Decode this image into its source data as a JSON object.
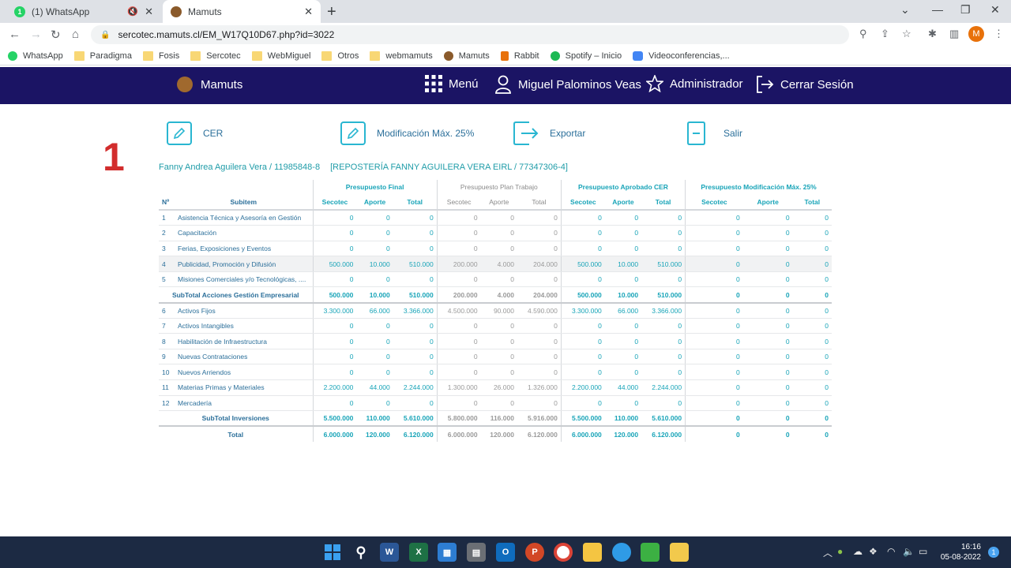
{
  "browser": {
    "tabs": [
      {
        "title": "(1) WhatsApp",
        "active": false
      },
      {
        "title": "Mamuts",
        "active": true
      }
    ],
    "url": "sercotec.mamuts.cl/EM_W17Q10D67.php?id=3022",
    "profile_initial": "M",
    "bookmarks": [
      {
        "label": "WhatsApp",
        "icon": "whatsapp-icon"
      },
      {
        "label": "Paradigma",
        "icon": "folder-icon"
      },
      {
        "label": "Fosis",
        "icon": "folder-icon"
      },
      {
        "label": "Sercotec",
        "icon": "folder-icon"
      },
      {
        "label": "WebMiguel",
        "icon": "folder-icon"
      },
      {
        "label": "Otros",
        "icon": "folder-icon"
      },
      {
        "label": "webmamuts",
        "icon": "folder-icon"
      },
      {
        "label": "Mamuts",
        "icon": "mamuts-icon"
      },
      {
        "label": "Rabbit",
        "icon": "rabbit-icon"
      },
      {
        "label": "Spotify – Inicio",
        "icon": "spotify-icon"
      },
      {
        "label": "Videoconferencias,...",
        "icon": "video-icon"
      }
    ]
  },
  "header": {
    "brand": "Mamuts",
    "menu": "Menú",
    "user": "Miguel Palominos Veas",
    "role": "Administrador",
    "logout": "Cerrar Sesión",
    "bg_color": "#1b1464"
  },
  "page": {
    "number": "1",
    "actions": {
      "cer": "CER",
      "modificacion": "Modificación Máx. 25%",
      "exportar": "Exportar",
      "salir": "Salir"
    },
    "owner": "Fanny Andrea Aguilera Vera / 11985848-8",
    "company": "[REPOSTERÍA FANNY AGUILERA VERA EIRL / 77347306-4]"
  },
  "table": {
    "groups": {
      "final": "Presupuesto Final",
      "plan": "Presupuesto Plan Trabajo",
      "cer": "Presupuesto Aprobado CER",
      "mod": "Presupuesto Modificación Máx. 25%"
    },
    "columns": {
      "n": "Nº",
      "subitem": "Subitem",
      "secotec": "Secotec",
      "aporte": "Aporte",
      "total": "Total"
    },
    "rows": [
      {
        "n": "1",
        "name": "Asistencia Técnica y Asesoría en Gestión",
        "final": [
          "0",
          "0",
          "0"
        ],
        "plan": [
          "0",
          "0",
          "0"
        ],
        "cer": [
          "0",
          "0",
          "0"
        ],
        "mod": [
          "0",
          "0",
          "0"
        ]
      },
      {
        "n": "2",
        "name": "Capacitación",
        "final": [
          "0",
          "0",
          "0"
        ],
        "plan": [
          "0",
          "0",
          "0"
        ],
        "cer": [
          "0",
          "0",
          "0"
        ],
        "mod": [
          "0",
          "0",
          "0"
        ]
      },
      {
        "n": "3",
        "name": "Ferias, Exposiciones y Eventos",
        "final": [
          "0",
          "0",
          "0"
        ],
        "plan": [
          "0",
          "0",
          "0"
        ],
        "cer": [
          "0",
          "0",
          "0"
        ],
        "mod": [
          "0",
          "0",
          "0"
        ]
      },
      {
        "n": "4",
        "name": "Publicidad, Promoción y Difusión",
        "final": [
          "500.000",
          "10.000",
          "510.000"
        ],
        "plan": [
          "200.000",
          "4.000",
          "204.000"
        ],
        "cer": [
          "500.000",
          "10.000",
          "510.000"
        ],
        "mod": [
          "0",
          "0",
          "0"
        ]
      },
      {
        "n": "5",
        "name": "Misiones Comerciales y/o Tecnológicas, ....",
        "final": [
          "0",
          "0",
          "0"
        ],
        "plan": [
          "0",
          "0",
          "0"
        ],
        "cer": [
          "0",
          "0",
          "0"
        ],
        "mod": [
          "0",
          "0",
          "0"
        ]
      },
      {
        "subtotal": true,
        "name": "SubTotal Acciones Gestión Empresarial",
        "final": [
          "500.000",
          "10.000",
          "510.000"
        ],
        "plan": [
          "200.000",
          "4.000",
          "204.000"
        ],
        "cer": [
          "500.000",
          "10.000",
          "510.000"
        ],
        "mod": [
          "0",
          "0",
          "0"
        ]
      },
      {
        "n": "6",
        "name": "Activos Fijos",
        "final": [
          "3.300.000",
          "66.000",
          "3.366.000"
        ],
        "plan": [
          "4.500.000",
          "90.000",
          "4.590.000"
        ],
        "cer": [
          "3.300.000",
          "66.000",
          "3.366.000"
        ],
        "mod": [
          "0",
          "0",
          "0"
        ]
      },
      {
        "n": "7",
        "name": "Activos Intangibles",
        "final": [
          "0",
          "0",
          "0"
        ],
        "plan": [
          "0",
          "0",
          "0"
        ],
        "cer": [
          "0",
          "0",
          "0"
        ],
        "mod": [
          "0",
          "0",
          "0"
        ]
      },
      {
        "n": "8",
        "name": "Habilitación de Infraestructura",
        "final": [
          "0",
          "0",
          "0"
        ],
        "plan": [
          "0",
          "0",
          "0"
        ],
        "cer": [
          "0",
          "0",
          "0"
        ],
        "mod": [
          "0",
          "0",
          "0"
        ]
      },
      {
        "n": "9",
        "name": "Nuevas Contrataciones",
        "final": [
          "0",
          "0",
          "0"
        ],
        "plan": [
          "0",
          "0",
          "0"
        ],
        "cer": [
          "0",
          "0",
          "0"
        ],
        "mod": [
          "0",
          "0",
          "0"
        ]
      },
      {
        "n": "10",
        "name": "Nuevos Arriendos",
        "final": [
          "0",
          "0",
          "0"
        ],
        "plan": [
          "0",
          "0",
          "0"
        ],
        "cer": [
          "0",
          "0",
          "0"
        ],
        "mod": [
          "0",
          "0",
          "0"
        ]
      },
      {
        "n": "11",
        "name": "Materias Primas y Materiales",
        "final": [
          "2.200.000",
          "44.000",
          "2.244.000"
        ],
        "plan": [
          "1.300.000",
          "26.000",
          "1.326.000"
        ],
        "cer": [
          "2.200.000",
          "44.000",
          "2.244.000"
        ],
        "mod": [
          "0",
          "0",
          "0"
        ]
      },
      {
        "n": "12",
        "name": "Mercadería",
        "final": [
          "0",
          "0",
          "0"
        ],
        "plan": [
          "0",
          "0",
          "0"
        ],
        "cer": [
          "0",
          "0",
          "0"
        ],
        "mod": [
          "0",
          "0",
          "0"
        ]
      },
      {
        "subtotal": true,
        "name": "SubTotal Inversiones",
        "final": [
          "5.500.000",
          "110.000",
          "5.610.000"
        ],
        "plan": [
          "5.800.000",
          "116.000",
          "5.916.000"
        ],
        "cer": [
          "5.500.000",
          "110.000",
          "5.610.000"
        ],
        "mod": [
          "0",
          "0",
          "0"
        ]
      },
      {
        "total": true,
        "name": "Total",
        "final": [
          "6.000.000",
          "120.000",
          "6.120.000"
        ],
        "plan": [
          "6.000.000",
          "120.000",
          "6.120.000"
        ],
        "cer": [
          "6.000.000",
          "120.000",
          "6.120.000"
        ],
        "mod": [
          "0",
          "0",
          "0"
        ]
      }
    ]
  },
  "taskbar": {
    "time": "16:16",
    "date": "05-08-2022",
    "notifications": "1"
  }
}
